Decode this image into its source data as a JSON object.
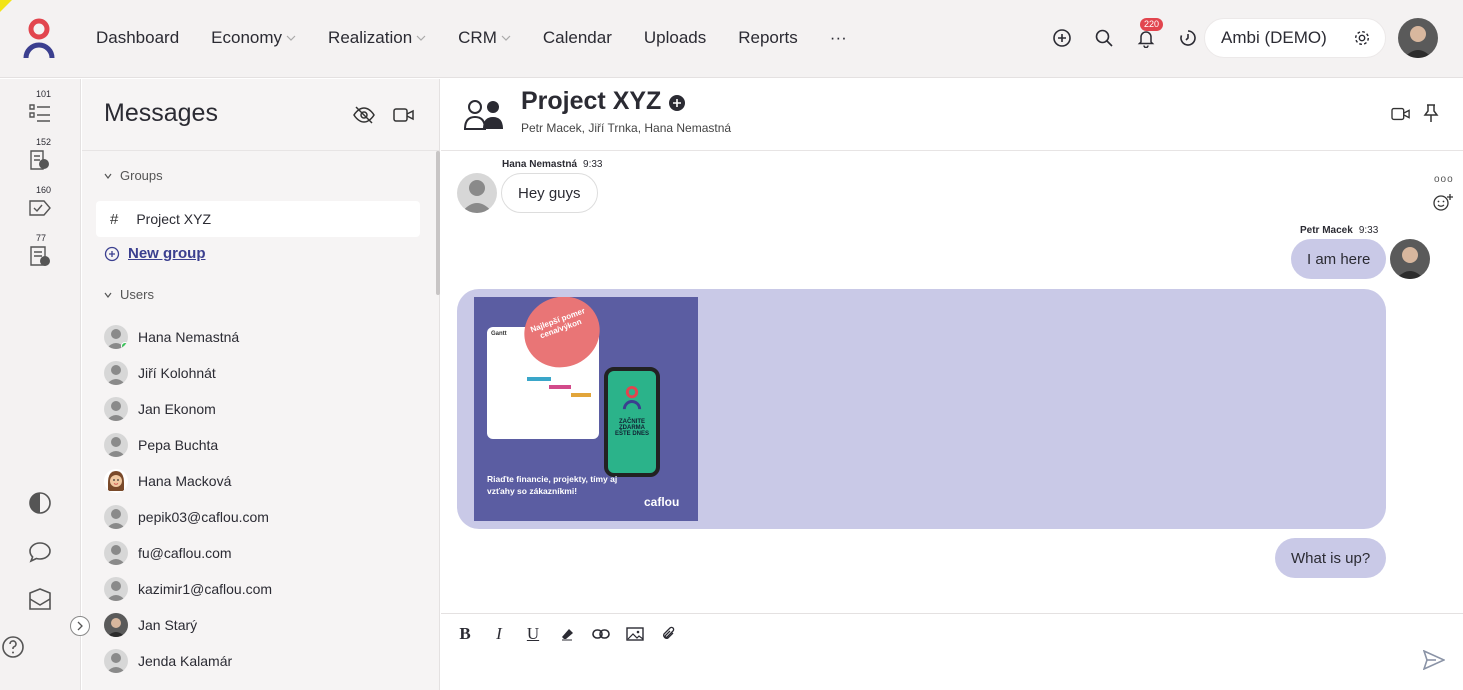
{
  "nav": {
    "items": [
      {
        "label": "Dashboard",
        "dropdown": false
      },
      {
        "label": "Economy",
        "dropdown": true
      },
      {
        "label": "Realization",
        "dropdown": true
      },
      {
        "label": "CRM",
        "dropdown": true
      },
      {
        "label": "Calendar",
        "dropdown": false
      },
      {
        "label": "Uploads",
        "dropdown": false
      },
      {
        "label": "Reports",
        "dropdown": false
      }
    ],
    "more": "···",
    "notification_count": "220",
    "account_label": "Ambi (DEMO)"
  },
  "rail": {
    "counts": [
      "101",
      "152",
      "160",
      "77"
    ]
  },
  "messages": {
    "title": "Messages",
    "groups_label": "Groups",
    "groups": [
      "Project XYZ"
    ],
    "new_group_label": "New group",
    "users_label": "Users",
    "users": [
      "Hana Nemastná",
      "Jiří Kolohnát",
      "Jan Ekonom",
      "Pepa Buchta",
      "Hana Macková",
      "pepik03@caflou.com",
      "fu@caflou.com",
      "kazimir1@caflou.com",
      "Jan Starý",
      "Jenda Kalamár"
    ]
  },
  "chat": {
    "title": "Project XYZ",
    "members": "Petr Macek, Jiří Trnka, Hana Nemastná",
    "messages": [
      {
        "author": "Hana Nemastná",
        "time": "9:33",
        "text": "Hey guys"
      },
      {
        "author": "Petr Macek",
        "time": "9:33",
        "text": "I am here"
      },
      {
        "text": "What is up?"
      }
    ],
    "ad": {
      "badge": "Najlepší pomer cena/výkon",
      "gantt_label": "Gantt",
      "phone_text": "ZAČNITE ZDARMA EŠTE DNES",
      "headline": "Riaďte financie, projekty, tímy aj vzťahy so zákazníkmi!",
      "brand": "caflou"
    }
  },
  "colors": {
    "accent": "#e2454e",
    "bubble_out": "#c9c9e7",
    "link": "#3b3f8f",
    "ad_bg": "#5b5da2"
  }
}
